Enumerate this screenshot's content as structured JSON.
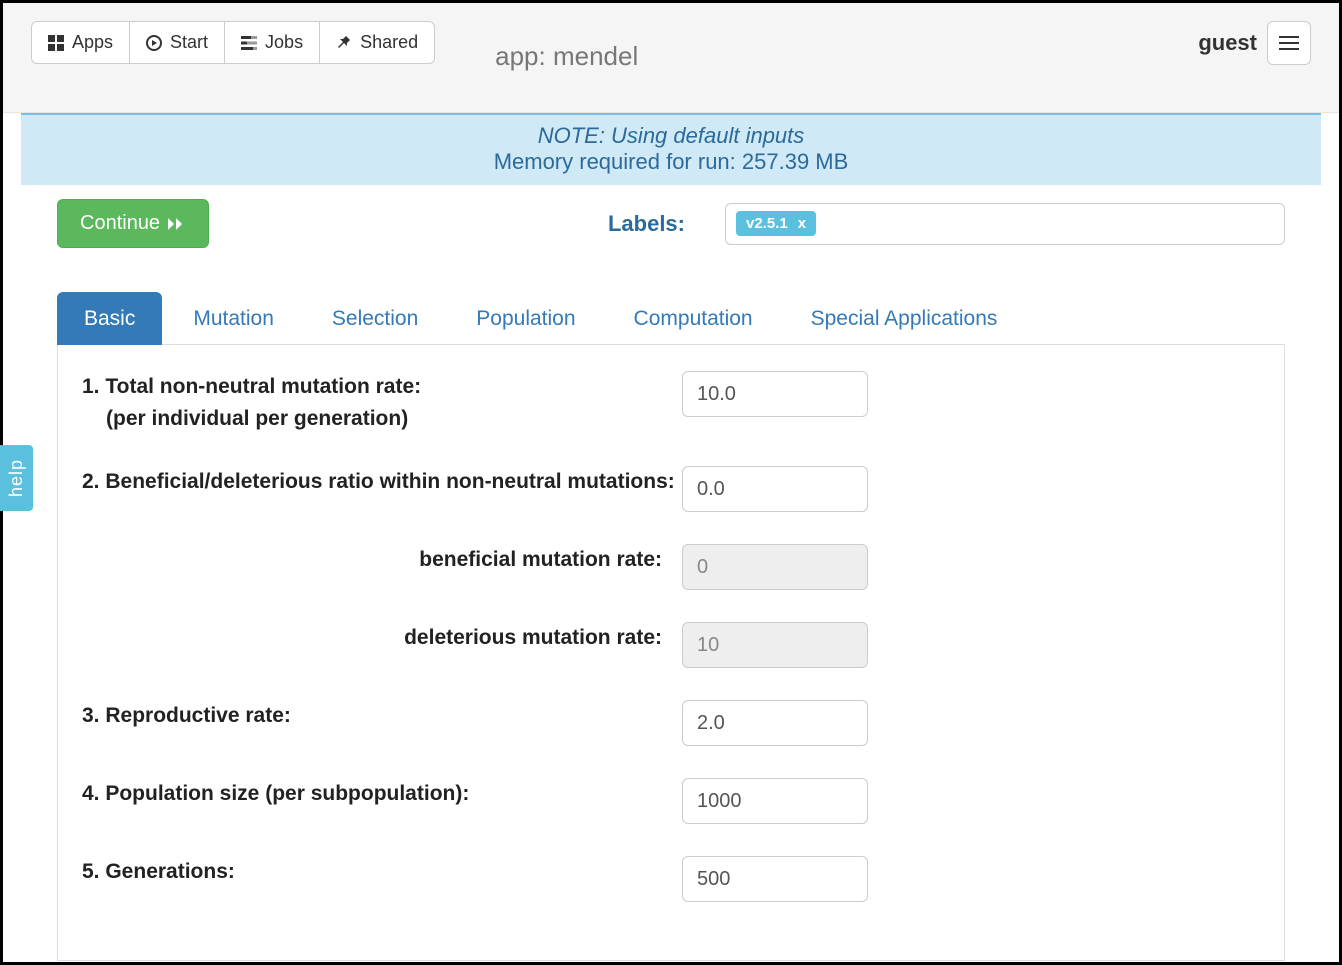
{
  "toolbar": {
    "apps": "Apps",
    "start": "Start",
    "jobs": "Jobs",
    "shared": "Shared"
  },
  "app_title": "app: mendel",
  "user": "guest",
  "banner": {
    "note": "NOTE: Using default inputs",
    "memory": "Memory required for run: 257.39 MB"
  },
  "continue_label": "Continue",
  "labels_label": "Labels:",
  "labels": [
    "v2.5.1"
  ],
  "tabs": [
    "Basic",
    "Mutation",
    "Selection",
    "Population",
    "Computation",
    "Special Applications"
  ],
  "active_tab": "Basic",
  "fields": {
    "f1": {
      "label": "1. Total non-neutral mutation rate:",
      "sublabel": "(per individual per generation)",
      "value": "10.0"
    },
    "f2": {
      "label": "2. Beneficial/deleterious ratio within non-neutral mutations:",
      "value": "0.0"
    },
    "f2a": {
      "label": "beneficial mutation rate:",
      "value": "0"
    },
    "f2b": {
      "label": "deleterious mutation rate:",
      "value": "10"
    },
    "f3": {
      "label": "3. Reproductive rate:",
      "value": "2.0"
    },
    "f4": {
      "label": "4. Population size (per subpopulation):",
      "value": "1000"
    },
    "f5": {
      "label": "5. Generations:",
      "value": "500"
    }
  },
  "help_label": "help"
}
